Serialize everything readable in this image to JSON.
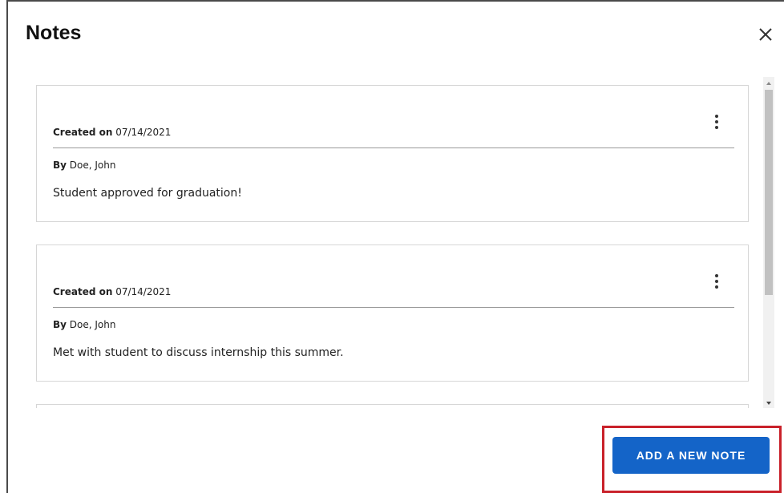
{
  "dialog": {
    "title": "Notes",
    "close_icon": "close-icon"
  },
  "notes": [
    {
      "created_label": "Created on",
      "created_date": "07/14/2021",
      "by_label": "By",
      "author": "Doe, John",
      "text": "Student approved for graduation!",
      "menu_icon": "more-vertical-icon"
    },
    {
      "created_label": "Created on",
      "created_date": "07/14/2021",
      "by_label": "By",
      "author": "Doe, John",
      "text": "Met with student to discuss internship this summer.",
      "menu_icon": "more-vertical-icon"
    }
  ],
  "scrollbar": {
    "up_icon": "arrow-up-icon",
    "down_icon": "arrow-down-icon"
  },
  "actions": {
    "add_label": "ADD A NEW NOTE"
  },
  "colors": {
    "primary_button": "#1464c8",
    "highlight_border": "#c9212a",
    "card_border": "#d6d6d6",
    "divider": "#9a9a9a"
  }
}
